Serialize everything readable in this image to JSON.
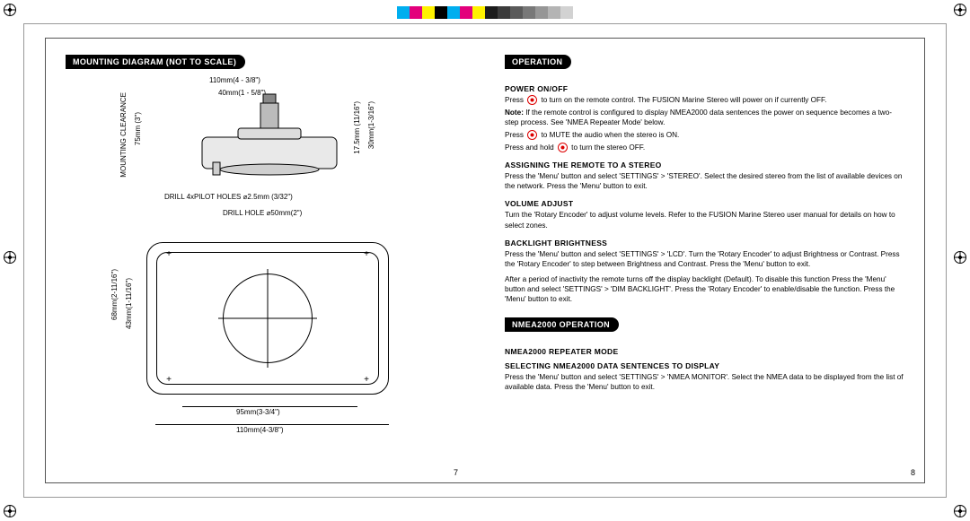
{
  "colorbar": [
    "#00AEEF",
    "#E3007B",
    "#FFF200",
    "#000000",
    "#00AEEF",
    "#E3007B",
    "#FFF200",
    "#1C1C1C",
    "#3B3B3B",
    "#5A5A5A",
    "#787878",
    "#969696",
    "#B4B4B4",
    "#D2D2D2"
  ],
  "left": {
    "heading": "MOUNTING DIAGRAM (NOT TO SCALE)",
    "dims": {
      "top_110": "110mm(4 - 3/8\")",
      "top_40": "40mm(1 - 5/8\")",
      "right_175": "17.5mm (11/16\")",
      "right_30": "30mm(1-3/16\")",
      "left_mount_clear": "MOUNTING CLEARANCE",
      "left_75": "75mm (3\")",
      "pilot": "DRILL 4xPILOT HOLES ⌀2.5mm (3/32\")",
      "drill_hole": "DRILL HOLE ⌀50mm(2\")",
      "side_68": "68mm(2-11/16\")",
      "side_43": "43mm(1-11/16\")",
      "bottom_95": "95mm(3-3/4\")",
      "bottom_110": "110mm(4-3/8\")"
    },
    "page": "7"
  },
  "right": {
    "heading1": "OPERATION",
    "power": {
      "title": "POWER ON/OFF",
      "p1_pre": "Press ",
      "p1_post": " to turn on the remote control. The FUSION Marine Stereo will power on if currently OFF.",
      "note_label": "Note:",
      "note_body": " If the remote control is configured to display NMEA2000 data sentences the power on sequence becomes a two-step process. See 'NMEA Repeater Mode' below.",
      "p2_pre": "Press ",
      "p2_post": " to MUTE the audio when the stereo is ON.",
      "p3_pre": "Press and hold ",
      "p3_post": " to turn the stereo OFF."
    },
    "assign": {
      "title": "ASSIGNING THE REMOTE TO A STEREO",
      "body": "Press the 'Menu' button and select 'SETTINGS' > 'STEREO'. Select the desired stereo from the list of available devices on the network. Press the 'Menu' button to exit."
    },
    "volume": {
      "title": "VOLUME ADJUST",
      "body": "Turn the 'Rotary Encoder' to adjust volume levels. Refer to the FUSION Marine Stereo user manual for details on how to select zones."
    },
    "backlight": {
      "title": "BACKLIGHT BRIGHTNESS",
      "body1": "Press the 'Menu' button and select 'SETTINGS' > 'LCD'. Turn the 'Rotary Encoder' to adjust Brightness or Contrast. Press the 'Rotary Encoder' to step between Brightness and Contrast. Press the 'Menu' button to exit.",
      "body2": "After a period of inactivity the remote turns off the display backlight (Default). To disable this function Press the 'Menu' button and select 'SETTINGS' > 'DIM BACKLIGHT'. Press the 'Rotary Encoder' to enable/disable the function. Press the 'Menu' button to exit."
    },
    "heading2": "NMEA2000 OPERATION",
    "nmea": {
      "title1": "NMEA2000 REPEATER MODE",
      "title2": "SELECTING NMEA2000 DATA SENTENCES TO DISPLAY",
      "body": "Press the 'Menu' button and select 'SETTINGS' > 'NMEA MONITOR'. Select the NMEA data to be displayed from the list of available data. Press the 'Menu' button to exit."
    },
    "page": "8"
  }
}
